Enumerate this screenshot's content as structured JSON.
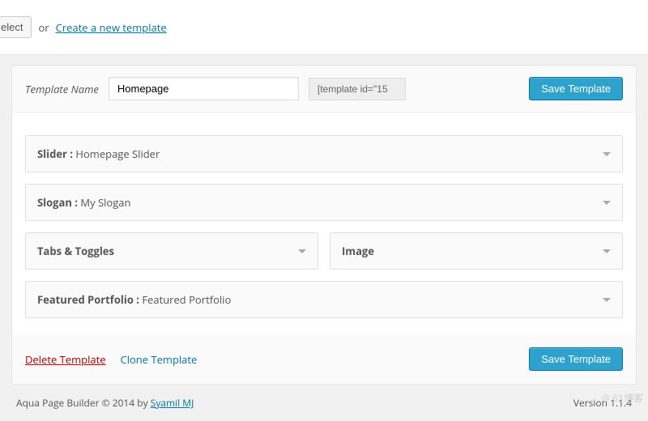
{
  "top": {
    "select_label": "elect",
    "or": "or",
    "create_link": "Create a new template"
  },
  "header": {
    "label": "Template Name",
    "name_value": "Homepage",
    "shortcode_value": "[template id=\"15",
    "save_label": "Save Template"
  },
  "blocks": {
    "slider_prefix": "Slider :",
    "slider_value": " Homepage Slider",
    "slogan_prefix": "Slogan :",
    "slogan_value": " My Slogan",
    "tabs_label": "Tabs & Toggles",
    "image_label": "Image",
    "portfolio_prefix": "Featured Portfolio :",
    "portfolio_value": " Featured Portfolio"
  },
  "actions": {
    "delete": "Delete Template",
    "clone": "Clone Template",
    "save": "Save Template"
  },
  "footer": {
    "copyright": "Aqua Page Builder © 2014 by ",
    "author": "Syamil MJ",
    "version": "Version 1.1.4"
  },
  "watermark": "@ 51博客"
}
